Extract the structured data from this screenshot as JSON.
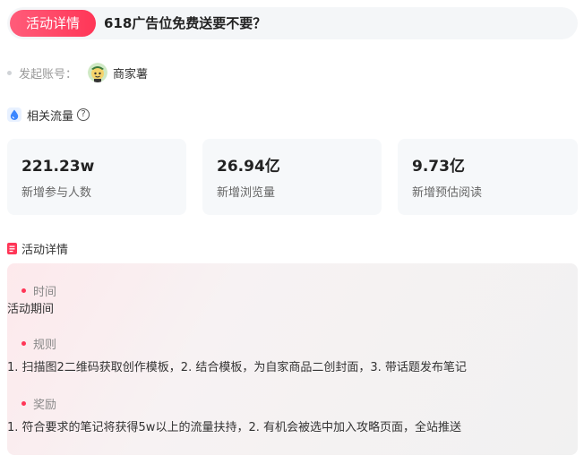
{
  "header": {
    "tag_label": "活动详情",
    "title": "618广告位免费送要不要？"
  },
  "initiator": {
    "label": "发起账号：",
    "name": "商家薯"
  },
  "traffic": {
    "title": "相关流量",
    "help_symbol": "?",
    "stats": [
      {
        "value": "221.23w",
        "label": "新增参与人数"
      },
      {
        "value": "26.94亿",
        "label": "新增浏览量"
      },
      {
        "value": "9.73亿",
        "label": "新增预估阅读"
      }
    ]
  },
  "details": {
    "title": "活动详情",
    "items": [
      {
        "heading": "时间",
        "text": "活动期间"
      },
      {
        "heading": "规则",
        "text": "1. 扫描图2二维码获取创作模板，2. 结合模板，为自家商品二创封面，3. 带话题发布笔记"
      },
      {
        "heading": "奖励",
        "text": "1. 符合要求的笔记将获得5w以上的流量扶持，2. 有机会被选中加入攻略页面，全站推送"
      }
    ]
  },
  "colors": {
    "accent": "#ff3657",
    "card_bg": "#f6f8fa"
  }
}
